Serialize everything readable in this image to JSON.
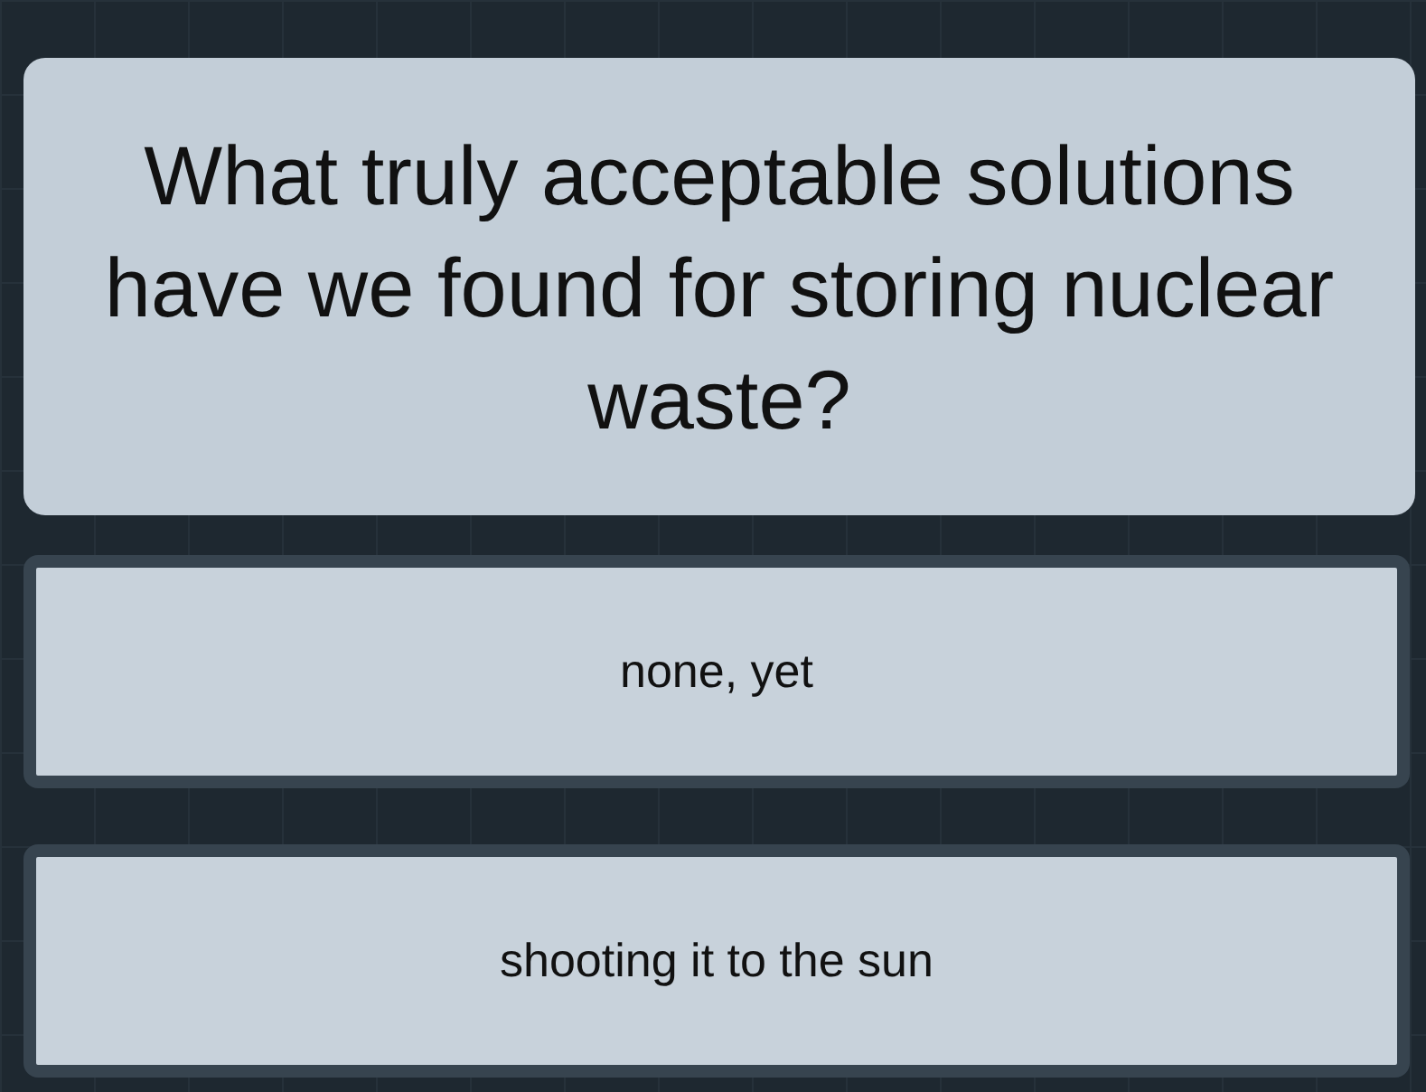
{
  "question": "What truly acceptable solutions have we found for storing nuclear waste?",
  "answers": [
    {
      "label": "none, yet"
    },
    {
      "label": "shooting it to the sun"
    }
  ]
}
